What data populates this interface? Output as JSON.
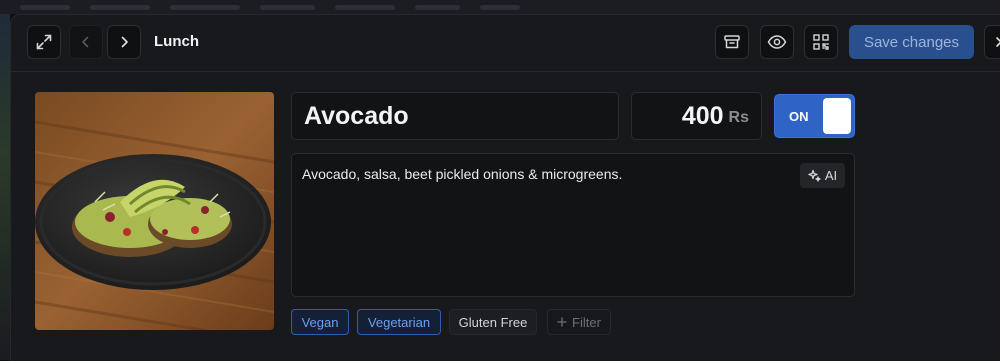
{
  "header": {
    "title": "Lunch",
    "save_label": "Save changes"
  },
  "item": {
    "name": "Avocado",
    "price": "400",
    "currency": "Rs",
    "availability_label": "ON",
    "available": true,
    "description": "Avocado, salsa, beet pickled onions & microgreens.",
    "ai_label": "AI"
  },
  "tags": [
    {
      "label": "Vegan",
      "selected": true
    },
    {
      "label": "Vegetarian",
      "selected": true
    },
    {
      "label": "Gluten Free",
      "selected": false
    }
  ],
  "filter_label": "Filter",
  "icons": {
    "expand": "expand-icon",
    "prev": "chevron-left-icon",
    "next": "chevron-right-icon",
    "archive": "archive-icon",
    "preview": "eye-icon",
    "qr": "qr-code-icon",
    "close": "close-icon",
    "ai": "sparkles-icon",
    "filter": "plus-icon"
  },
  "colors": {
    "accent": "#2f63c6",
    "save_button": "#2a4f8f",
    "modal_bg": "#18191c",
    "field_bg": "#121315"
  }
}
